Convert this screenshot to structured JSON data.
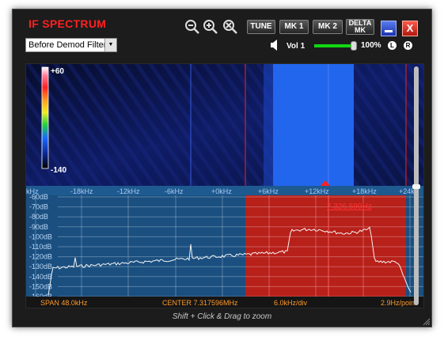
{
  "title": "IF SPECTRUM",
  "filter_select": {
    "value": "Before Demod Filter"
  },
  "toolbar": {
    "tune": "TUNE",
    "mk1": "MK 1",
    "mk2": "MK 2",
    "delta_line1": "DELTA",
    "delta_line2": "MK",
    "close": "X"
  },
  "volume": {
    "label": "Vol 1",
    "percent": "100%",
    "level": 1.0,
    "left": "L",
    "right": "R"
  },
  "waterfall": {
    "max_label": "+60",
    "min_label": "-140"
  },
  "freq_axis": [
    "kHz",
    "-18kHz",
    "-12kHz",
    "-6kHz",
    "+0kHz",
    "+6kHz",
    "+12kHz",
    "+18kHz",
    "+24k"
  ],
  "db_axis": [
    "-60dB",
    "-70dB",
    "-80dB",
    "-90dB",
    "-100dB",
    "-110dB",
    "-120dB",
    "-130dB",
    "-140dB",
    "-150dB",
    "-160dB"
  ],
  "marker_readout": "7.326.599Hz",
  "status": {
    "span": "SPAN 48.0kHz",
    "center": "CENTER 7.317596MHz",
    "per_div": "6.0kHz/div",
    "resolution": "2.9Hz/point"
  },
  "hint": "Shift + Click & Drag to zoom",
  "colors": {
    "title": "#ff2020",
    "panel_bg": "#1a4f80",
    "filter_band": "#b8201a",
    "status_text": "#ff9a2a",
    "waterfall_band": "#2266ee"
  }
}
